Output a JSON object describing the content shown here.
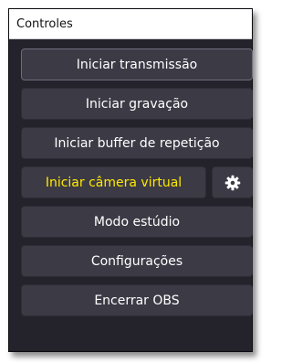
{
  "dock": {
    "title": "Controles"
  },
  "controls": {
    "start_streaming": "Iniciar transmissão",
    "start_recording": "Iniciar gravação",
    "start_replay_buffer": "Iniciar buffer de repetição",
    "start_virtual_camera": "Iniciar câmera virtual",
    "virtual_camera_settings_icon": "gear-icon",
    "studio_mode": "Modo estúdio",
    "settings": "Configurações",
    "exit": "Encerrar OBS"
  },
  "colors": {
    "panel_background": "#24232b",
    "button_background": "#3c3a45",
    "button_text": "#ffffff",
    "virtual_camera_text": "#ffea00"
  }
}
